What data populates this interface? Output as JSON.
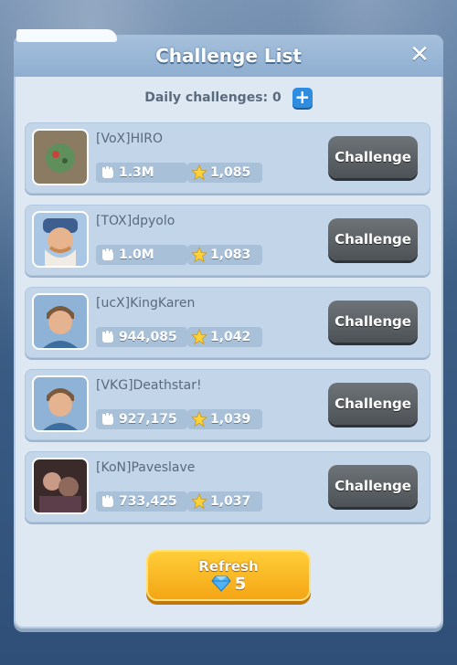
{
  "header": {
    "title": "Challenge List",
    "close_icon": "close-icon"
  },
  "daily": {
    "label": "Daily challenges: 0",
    "add_icon": "plus-icon"
  },
  "challenge_button_label": "Challenge",
  "players": [
    {
      "name": "[VoX]HIRO",
      "power": "1.3M",
      "trophies": "1,085",
      "avatar": "green-creature-avatar"
    },
    {
      "name": "[TOX]dpyolo",
      "power": "1.0M",
      "trophies": "1,083",
      "avatar": "bearded-hat-avatar"
    },
    {
      "name": "[ucX]KingKaren",
      "power": "944,085",
      "trophies": "1,042",
      "avatar": "hero-avatar"
    },
    {
      "name": "[VKG]Deathstar!",
      "power": "927,175",
      "trophies": "1,039",
      "avatar": "hero-avatar"
    },
    {
      "name": "[KoN]Paveslave",
      "power": "733,425",
      "trophies": "1,037",
      "avatar": "photo-avatar"
    }
  ],
  "refresh": {
    "label": "Refresh",
    "cost": "5",
    "cost_icon": "gem-icon"
  },
  "colors": {
    "panel": "#dde8f3",
    "row": "#c3d5e9",
    "button": "#5c6166",
    "refresh": "#f8b820",
    "accent": "#2f8de0"
  }
}
